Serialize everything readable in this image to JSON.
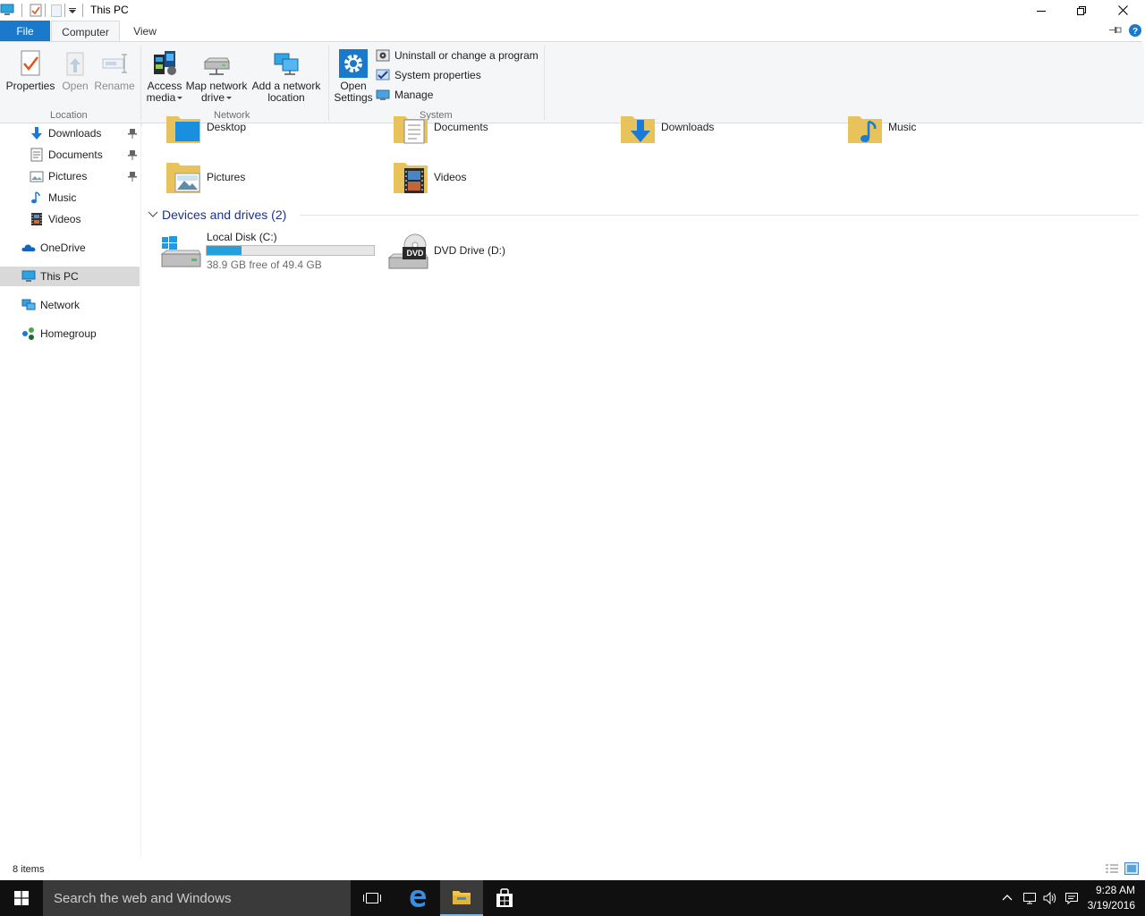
{
  "window": {
    "title": "This PC"
  },
  "ribbon_tabs": {
    "file": "File",
    "computer": "Computer",
    "view": "View"
  },
  "ribbon": {
    "location": {
      "label": "Location",
      "properties": "Properties",
      "open": "Open",
      "rename": "Rename"
    },
    "network": {
      "label": "Network",
      "access_media_l1": "Access",
      "access_media_l2": "media",
      "map_drive_l1": "Map network",
      "map_drive_l2": "drive",
      "add_location_l1": "Add a network",
      "add_location_l2": "location"
    },
    "system": {
      "label": "System",
      "open_settings_l1": "Open",
      "open_settings_l2": "Settings",
      "uninstall": "Uninstall or change a program",
      "system_properties": "System properties",
      "manage": "Manage"
    }
  },
  "nav": {
    "quick_access": [
      "Downloads",
      "Documents",
      "Pictures",
      "Music",
      "Videos"
    ],
    "onedrive": "OneDrive",
    "this_pc": "This PC",
    "network": "Network",
    "homegroup": "Homegroup"
  },
  "folders": [
    "Desktop",
    "Documents",
    "Downloads",
    "Music",
    "Pictures",
    "Videos"
  ],
  "devices_group": {
    "label": "Devices and drives (2)"
  },
  "drives": {
    "c": {
      "name": "Local Disk (C:)",
      "free_text": "38.9 GB free of 49.4 GB",
      "used_fraction": 0.21
    },
    "d": {
      "name": "DVD Drive (D:)",
      "badge": "DVD"
    }
  },
  "status": {
    "items": "8 items"
  },
  "taskbar": {
    "search_placeholder": "Search the web and Windows",
    "time": "9:28 AM",
    "date": "3/19/2016"
  },
  "colors": {
    "accent": "#1979ca",
    "selection": "#d9d9d9",
    "drive_bar": "#26a0da",
    "taskbar": "#101010"
  }
}
